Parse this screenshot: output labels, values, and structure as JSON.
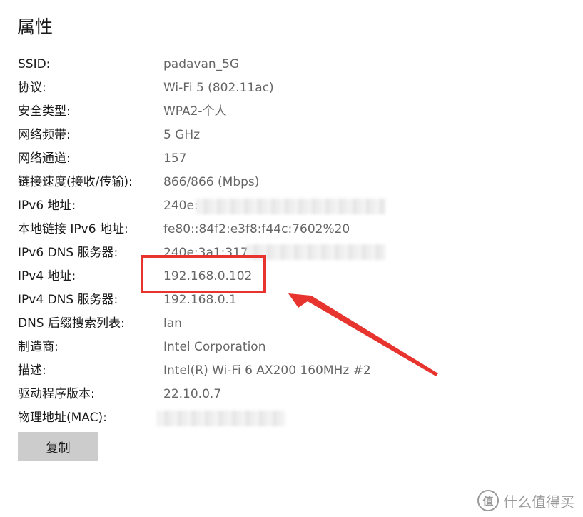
{
  "title": "属性",
  "properties": [
    {
      "label": "SSID:",
      "value": "padavan_5G"
    },
    {
      "label": "协议:",
      "value": "Wi-Fi 5 (802.11ac)"
    },
    {
      "label": "安全类型:",
      "value": "WPA2-个人"
    },
    {
      "label": "网络频带:",
      "value": "5 GHz"
    },
    {
      "label": "网络通道:",
      "value": "157"
    },
    {
      "label": "链接速度(接收/传输):",
      "value": "866/866 (Mbps)"
    },
    {
      "label": "IPv6 地址:",
      "value": "240e:"
    },
    {
      "label": "本地链接 IPv6 地址:",
      "value": "fe80::84f2:e3f8:f44c:7602%20"
    },
    {
      "label": "IPv6 DNS 服务器:",
      "value": "240e:3a1:317:9("
    },
    {
      "label": "IPv4 地址:",
      "value": "192.168.0.102"
    },
    {
      "label": "IPv4 DNS 服务器:",
      "value": "192.168.0.1"
    },
    {
      "label": "DNS 后缀搜索列表:",
      "value": "lan"
    },
    {
      "label": "制造商:",
      "value": "Intel Corporation"
    },
    {
      "label": "描述:",
      "value": "Intel(R) Wi-Fi 6 AX200 160MHz #2"
    },
    {
      "label": "驱动程序版本:",
      "value": "22.10.0.7"
    },
    {
      "label": "物理地址(MAC):",
      "value": ""
    }
  ],
  "copy_button": {
    "label": "复制"
  },
  "watermark": {
    "text": "什么值得买",
    "logo_glyph": "值"
  },
  "colors": {
    "highlight": "#e8342f",
    "value_text": "#666666",
    "button_bg": "#cccccc"
  }
}
